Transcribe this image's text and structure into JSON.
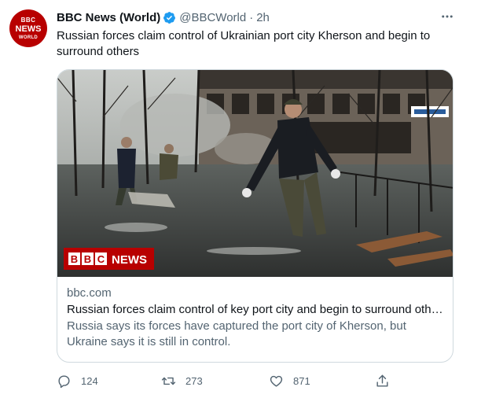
{
  "author": {
    "avatar_lines": [
      "BBC",
      "NEWS",
      "WORLD"
    ],
    "display_name": "BBC News (World)",
    "handle": "@BBCWorld",
    "separator": "·",
    "timestamp": "2h",
    "verified": true
  },
  "tweet": {
    "text": "Russian forces claim control of Ukrainian port city Kherson and begin to surround others"
  },
  "card": {
    "image_logo_text": "BBC NEWS",
    "domain": "bbc.com",
    "title": "Russian forces claim control of key port city and begin to surround others",
    "description": "Russia says its forces have captured the port city of Kherson, but Ukraine says it is still in control."
  },
  "actions": {
    "reply_count": "124",
    "retweet_count": "273",
    "like_count": "871"
  },
  "colors": {
    "brand_red": "#b80000",
    "verified_blue": "#1d9bf0",
    "secondary_text": "#536471",
    "border": "#cfd9de"
  },
  "icons": [
    "more-icon",
    "verified-icon",
    "reply-icon",
    "retweet-icon",
    "like-icon",
    "share-icon"
  ]
}
